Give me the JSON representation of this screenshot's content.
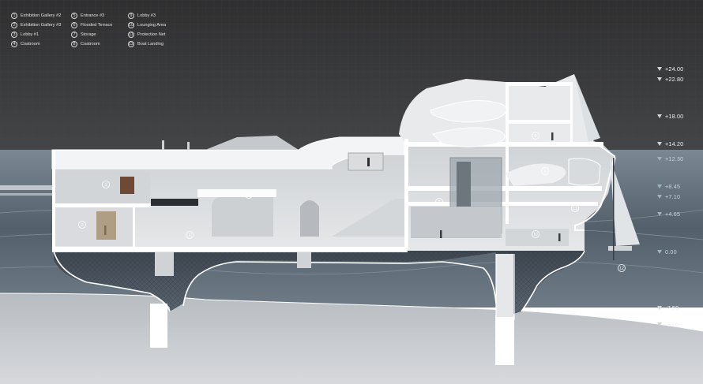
{
  "legend": {
    "items": [
      {
        "num": "1",
        "label": "Exhibition Gallery #2"
      },
      {
        "num": "2",
        "label": "Exhibition Gallery #3"
      },
      {
        "num": "3",
        "label": "Lobby #1"
      },
      {
        "num": "4",
        "label": "Coatroom"
      },
      {
        "num": "5",
        "label": "Entrance #3"
      },
      {
        "num": "6",
        "label": "Flooded Terrace"
      },
      {
        "num": "7",
        "label": "Storage"
      },
      {
        "num": "8",
        "label": "Coatroom"
      },
      {
        "num": "9",
        "label": "Lobby #3"
      },
      {
        "num": "10",
        "label": "Lounging Area"
      },
      {
        "num": "11",
        "label": "Protection Net"
      },
      {
        "num": "12",
        "label": "Boat Landing"
      }
    ]
  },
  "levels": [
    {
      "label": "+24.00"
    },
    {
      "label": "+22.80"
    },
    {
      "label": "+18.00"
    },
    {
      "label": "+14.20"
    },
    {
      "label": "+12.30"
    },
    {
      "label": "+8.45"
    },
    {
      "label": "+7.10"
    },
    {
      "label": "+4.65"
    },
    {
      "label": "0.00"
    },
    {
      "label": "-7.50"
    },
    {
      "label": "-9.60"
    }
  ],
  "room_labels": [
    "1",
    "2",
    "3",
    "4",
    "6",
    "8",
    "9",
    "10",
    "11",
    "12"
  ],
  "colors": {
    "sky": "#3a3a3b",
    "water": "#56606b",
    "water_light": "#8a98a5",
    "building": "#e2e4e6",
    "section_cut": "#ffffff",
    "ground": "#c9ccd0"
  }
}
